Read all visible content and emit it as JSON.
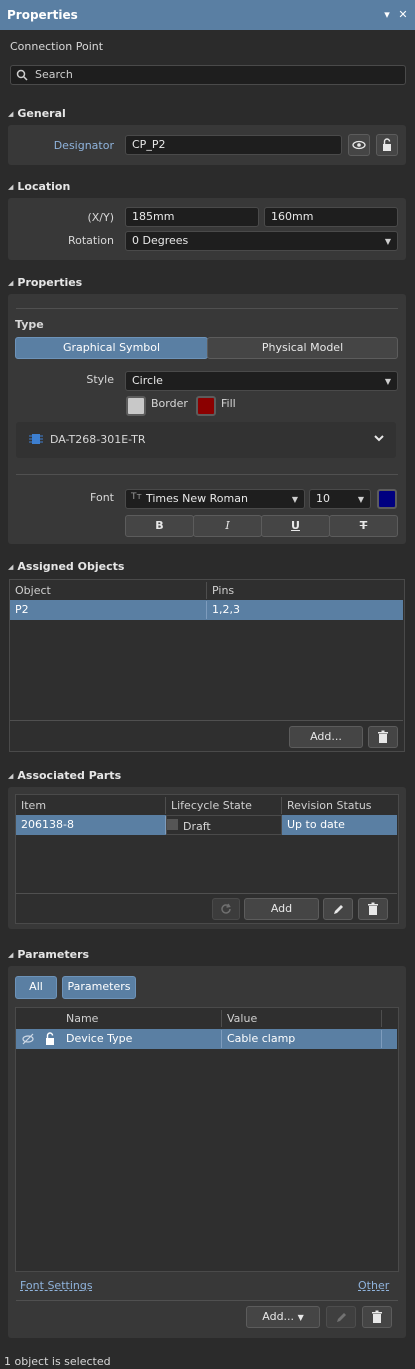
{
  "window": {
    "title": "Properties",
    "pin_glyph": "▾",
    "close_glyph": "✕"
  },
  "object_type": "Connection Point",
  "search": {
    "placeholder": "Search"
  },
  "general": {
    "header": "General",
    "designator_label": "Designator",
    "designator_value": "CP_P2"
  },
  "location": {
    "header": "Location",
    "xy_label": "(X/Y)",
    "x_value": "185mm",
    "y_value": "160mm",
    "rotation_label": "Rotation",
    "rotation_value": "0 Degrees"
  },
  "properties": {
    "header": "Properties",
    "type_label": "Type",
    "type_options": [
      "Graphical Symbol",
      "Physical Model"
    ],
    "type_selected": "Graphical Symbol",
    "style_label": "Style",
    "style_value": "Circle",
    "border_label": "Border",
    "border_color": "#c8c8c8",
    "fill_label": "Fill",
    "fill_color": "#8b0000",
    "component_name": "DA-T268-301E-TR",
    "font_label": "Font",
    "font_value": "Times New Roman",
    "font_size": "10",
    "font_color": "#000080",
    "format_buttons": [
      "B",
      "I",
      "U",
      "T"
    ]
  },
  "assigned_objects": {
    "header": "Assigned Objects",
    "columns": [
      "Object",
      "Pins"
    ],
    "rows": [
      [
        "P2",
        "1,2,3"
      ]
    ],
    "add_label": "Add..."
  },
  "associated_parts": {
    "header": "Associated Parts",
    "columns": [
      "Item",
      "Lifecycle State",
      "Revision Status"
    ],
    "rows": [
      [
        "206138-8",
        "Draft",
        "Up to date"
      ]
    ],
    "add_label": "Add"
  },
  "parameters": {
    "header": "Parameters",
    "filter_all": "All",
    "filter_parameters": "Parameters",
    "columns": [
      "Name",
      "Value"
    ],
    "rows": [
      [
        "Device Type",
        "Cable clamp"
      ]
    ],
    "font_settings_link": "Font Settings",
    "other_link": "Other",
    "add_label": "Add..."
  },
  "status": "1 object is selected",
  "colors": {
    "accent": "#5a7fa3",
    "link": "#8fb3dc"
  }
}
